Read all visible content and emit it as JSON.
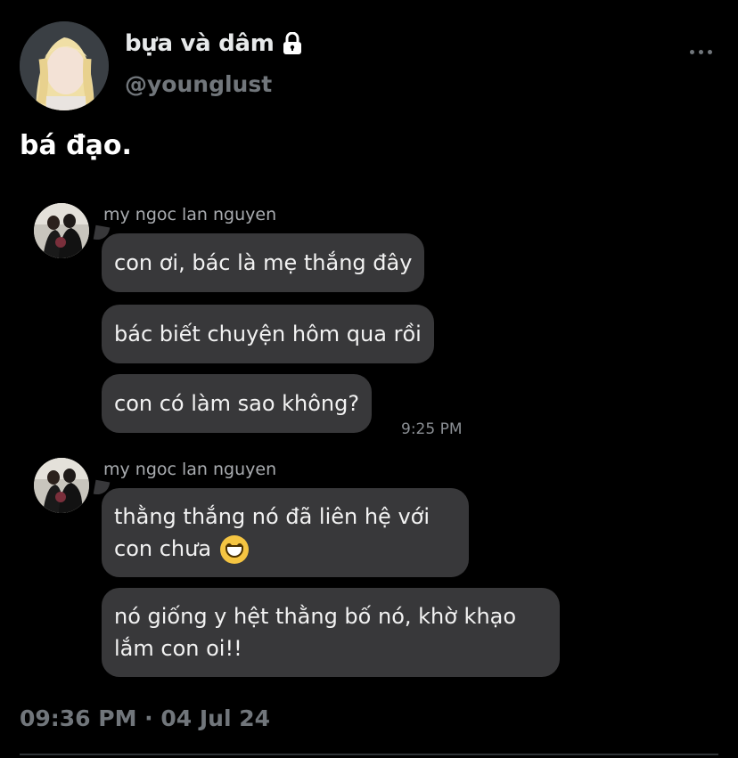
{
  "author": {
    "name": "bựa và dâm",
    "handle": "@younglust",
    "avatar_icon": "profile-avatar",
    "lock_icon": "lock-icon"
  },
  "tweet": {
    "text": "bá đạo.",
    "timestamp": "09:36 PM · 04 Jul 24"
  },
  "chat": {
    "groups": [
      {
        "sender": "my ngoc lan nguyen",
        "messages": [
          "con ơi, bác là mẹ thắng đây",
          "bác biết chuyện hôm qua rồi",
          "con có làm sao không?"
        ],
        "time": "9:25 PM"
      },
      {
        "sender": "my ngoc lan nguyen",
        "messages": [
          "thằng thắng nó đã liên hệ với con chưa",
          "nó giống y hệt thằng bố nó, khờ khạo lắm con oi!!"
        ],
        "emoji": "grinning-face-emoji"
      }
    ]
  },
  "colors": {
    "background": "#000000",
    "bubble": "#38383a",
    "secondary_text": "#71767b"
  }
}
